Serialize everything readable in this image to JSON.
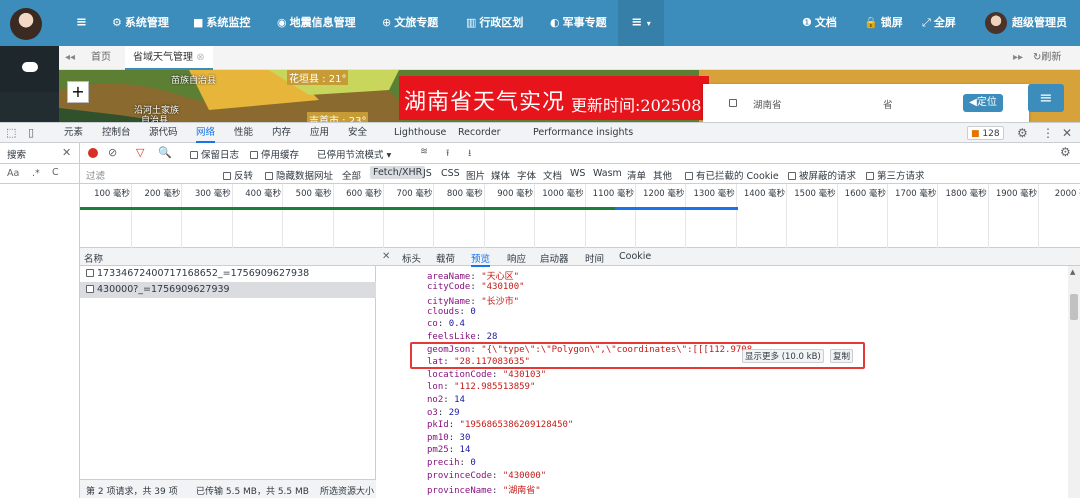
{
  "nav": {
    "items": [
      {
        "icon": "⚙",
        "label": "系统管理"
      },
      {
        "icon": "■",
        "label": "系统监控"
      },
      {
        "icon": "◉",
        "label": "地震信息管理"
      },
      {
        "icon": "⊕",
        "label": "文旅专题"
      },
      {
        "icon": "▥",
        "label": "行政区划"
      },
      {
        "icon": "◐",
        "label": "军事专题"
      }
    ],
    "more_icon": "≡",
    "right": [
      {
        "icon": "❶",
        "label": "文档"
      },
      {
        "icon": "🔒",
        "label": "锁屏"
      },
      {
        "icon": "⤢",
        "label": "全屏"
      }
    ],
    "user": "超级管理员"
  },
  "tabs": {
    "home": "首页",
    "active": "省域天气管理",
    "refresh": "刷新"
  },
  "map": {
    "labels": [
      "苗族自治县",
      "沿河土家族",
      "自治县",
      "花垣县 : 21°",
      "吉首市 : 23°"
    ],
    "banner_title": "湖南省天气实况",
    "banner_time": "更新时间:202508",
    "province_label": "湖南省",
    "province_select": "省",
    "locate_button": "定位"
  },
  "devtools": {
    "tabs": [
      "元素",
      "控制台",
      "源代码",
      "网络",
      "性能",
      "内存",
      "应用",
      "安全",
      "Lighthouse",
      "Recorder",
      "Performance insights"
    ],
    "active_tab": "网络",
    "issue_count": "128",
    "search_label": "搜索",
    "toolbar": {
      "preserve_log": "保留日志",
      "disable_cache": "停用缓存",
      "throttle": "已停用节流模式"
    },
    "filter": {
      "placeholder": "过滤",
      "invert": "反转",
      "hide_data_urls": "隐藏数据网址",
      "types": [
        "全部",
        "Fetch/XHR",
        "JS",
        "CSS",
        "图片",
        "媒体",
        "字体",
        "文档",
        "WS",
        "Wasm",
        "清单",
        "其他"
      ],
      "active_type": "Fetch/XHR",
      "blocked_cookies": "有已拦截的 Cookie",
      "blocked_requests": "被屏蔽的请求",
      "third_party": "第三方请求"
    },
    "timeline_ticks": [
      "100 毫秒",
      "200 毫秒",
      "300 毫秒",
      "400 毫秒",
      "500 毫秒",
      "600 毫秒",
      "700 毫秒",
      "800 毫秒",
      "900 毫秒",
      "1000 毫秒",
      "1100 毫秒",
      "1200 毫秒",
      "1300 毫秒",
      "1400 毫秒",
      "1500 毫秒",
      "1600 毫秒",
      "1700 毫秒",
      "1800 毫秒",
      "1900 毫秒",
      "2000 毫"
    ],
    "name_header": "名称",
    "requests": [
      "17334672400717168652_=1756909627938",
      "430000?_=1756909627939"
    ],
    "status": {
      "requests": "第 2 项请求，共 39 项",
      "transferred": "已传输 5.5 MB，共 5.5 MB",
      "resources": "所选资源大小"
    },
    "detail_tabs": [
      "标头",
      "载荷",
      "预览",
      "响应",
      "启动器",
      "时间",
      "Cookie"
    ],
    "active_detail_tab": "预览",
    "props": [
      {
        "key": "areaName",
        "value": "\"天心区\"",
        "type": "s"
      },
      {
        "key": "cityCode",
        "value": "\"430100\"",
        "type": "s"
      },
      {
        "key": "cityName",
        "value": "\"长沙市\"",
        "type": "s"
      },
      {
        "key": "clouds",
        "value": "0",
        "type": "n"
      },
      {
        "key": "co",
        "value": "0.4",
        "type": "n"
      },
      {
        "key": "feelsLike",
        "value": "28",
        "type": "n"
      },
      {
        "key": "geomJson",
        "value": "\"{\\\"type\\\":\\\"Polygon\\\",\\\"coordinates\\\":[[[112.9708",
        "type": "s"
      },
      {
        "key": "lat",
        "value": "\"28.117083635\"",
        "type": "s"
      },
      {
        "key": "locationCode",
        "value": "\"430103\"",
        "type": "s"
      },
      {
        "key": "lon",
        "value": "\"112.985513859\"",
        "type": "s"
      },
      {
        "key": "no2",
        "value": "14",
        "type": "n"
      },
      {
        "key": "o3",
        "value": "29",
        "type": "n"
      },
      {
        "key": "pkId",
        "value": "\"1956865386209128450\"",
        "type": "s"
      },
      {
        "key": "pm10",
        "value": "30",
        "type": "n"
      },
      {
        "key": "pm25",
        "value": "14",
        "type": "n"
      },
      {
        "key": "precih",
        "value": "0",
        "type": "n"
      },
      {
        "key": "provinceCode",
        "value": "\"430000\"",
        "type": "s"
      },
      {
        "key": "provinceName",
        "value": "\"湖南省\"",
        "type": "s"
      }
    ],
    "show_more": "显示更多 (10.0 kB)",
    "copy": "复制"
  },
  "colors": {
    "nav": "#3c8dbc",
    "sidebar": "#222d32",
    "banner": "#e8141b",
    "highlight_box": "#e53935"
  }
}
